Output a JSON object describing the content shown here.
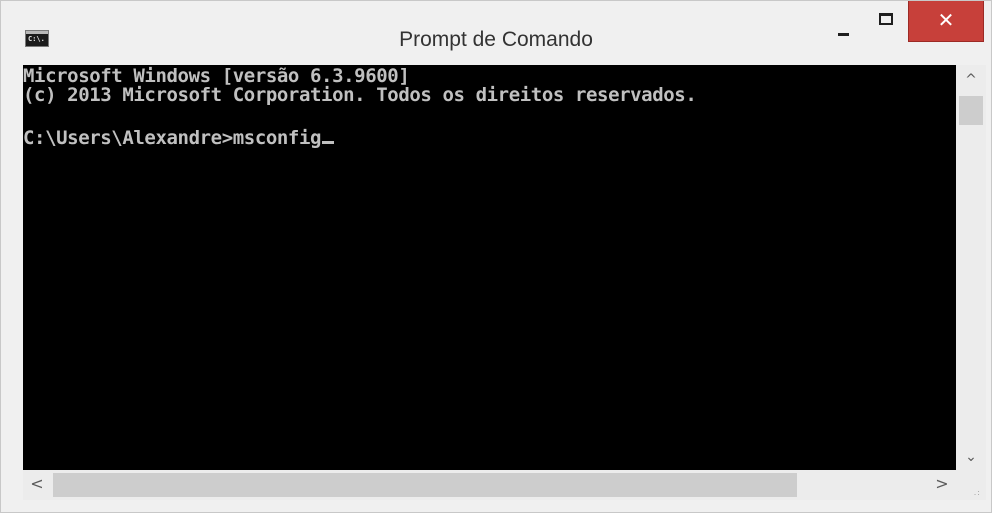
{
  "window": {
    "title": "Prompt de Comando",
    "icon_name": "cmd-icon",
    "icon_text": "C:\\.",
    "buttons": {
      "minimize_icon": "minimize-icon",
      "maximize_icon": "maximize-icon",
      "close_icon": "close-icon",
      "close_glyph": "✕",
      "close_color": "#c7403a"
    }
  },
  "console": {
    "background": "#000000",
    "foreground": "#c0c0c0",
    "lines": [
      "Microsoft Windows [versão 6.3.9600]",
      "(c) 2013 Microsoft Corporation. Todos os direitos reservados.",
      "",
      "C:\\Users\\Alexandre>msconfig"
    ]
  },
  "scrollbars": {
    "up_arrow": "^",
    "down_arrow": "⌄",
    "left_arrow": "<",
    "right_arrow": ">",
    "grip": ".:"
  }
}
